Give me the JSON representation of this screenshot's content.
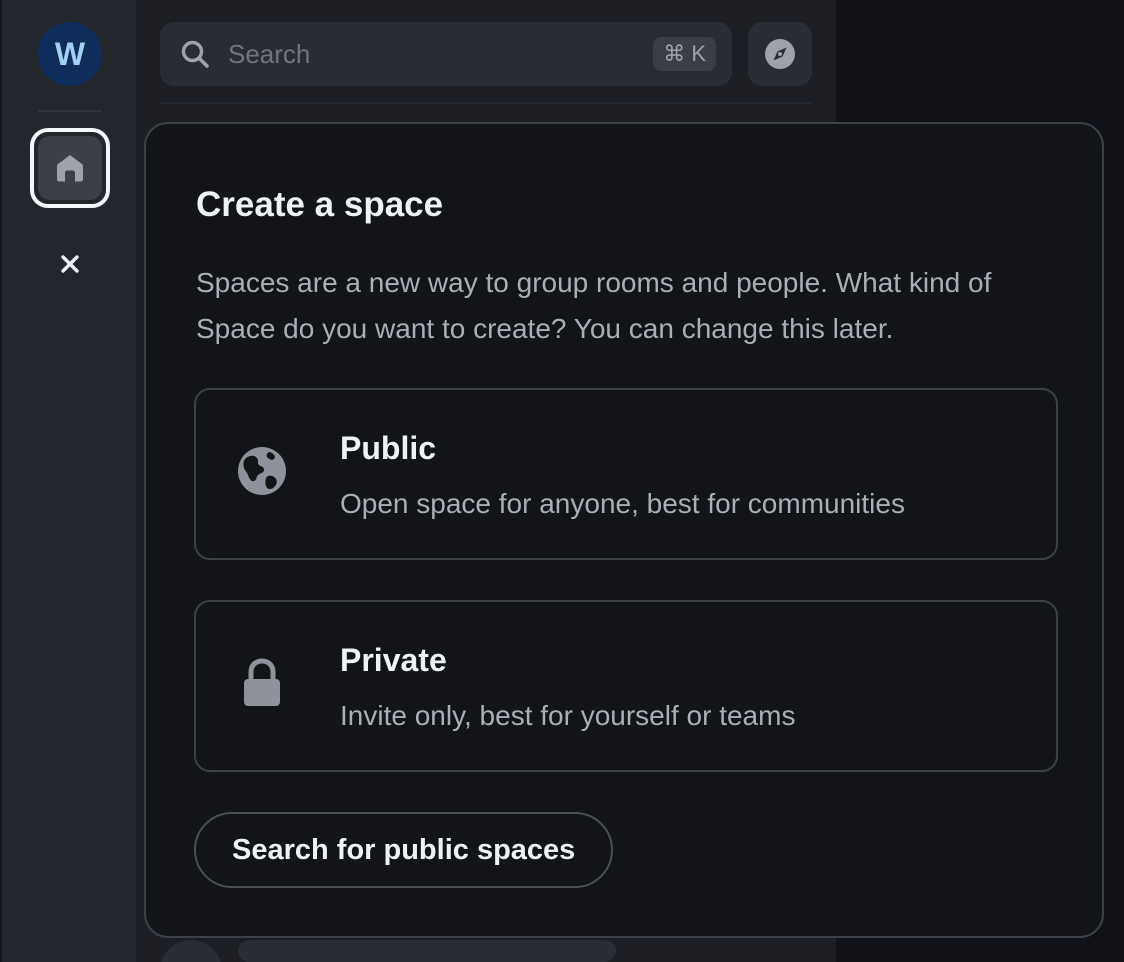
{
  "spacebar": {
    "avatar_letter": "W",
    "home_icon": "home-icon",
    "close_icon": "close-icon"
  },
  "roomlist": {
    "search": {
      "placeholder": "Search",
      "shortcut": "⌘ K"
    },
    "explore_icon": "compass-icon"
  },
  "menu": {
    "title": "Create a space",
    "description": "Spaces are a new way to group rooms and people. What kind of Space do you want to create? You can change this later.",
    "options": [
      {
        "icon": "globe-icon",
        "title": "Public",
        "description": "Open space for anyone, best for communities"
      },
      {
        "icon": "lock-icon",
        "title": "Private",
        "description": "Invite only, best for yourself or teams"
      }
    ],
    "search_public_label": "Search for public spaces"
  },
  "colors": {
    "background": "#101217",
    "panel": "#1c1e24",
    "menu_bg": "#121418",
    "text_primary": "#eef1f6",
    "text_secondary": "#a9aeb7",
    "avatar_bg": "#0f2d5c",
    "avatar_fg": "#9fd2f0",
    "icon_gray": "#8d929b"
  }
}
